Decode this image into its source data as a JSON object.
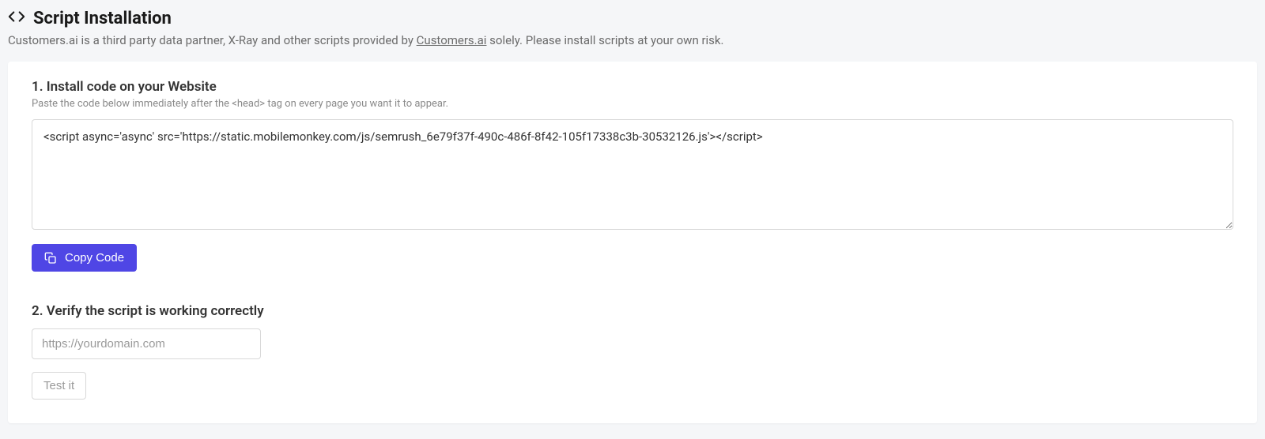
{
  "header": {
    "title": "Script Installation",
    "subtitle_before": "Customers.ai is a third party data partner, X-Ray and other scripts provided by ",
    "subtitle_link": "Customers.ai",
    "subtitle_after": " solely. Please install scripts at your own risk."
  },
  "step1": {
    "title": "1. Install code on your Website",
    "desc": "Paste the code below immediately after the <head> tag on every page you want it to appear.",
    "code": "<script async='async' src='https://static.mobilemonkey.com/js/semrush_6e79f37f-490c-486f-8f42-105f17338c3b-30532126.js'></script>",
    "copy_label": "Copy Code"
  },
  "step2": {
    "title": "2. Verify the script is working correctly",
    "placeholder": "https://yourdomain.com",
    "test_label": "Test it"
  }
}
